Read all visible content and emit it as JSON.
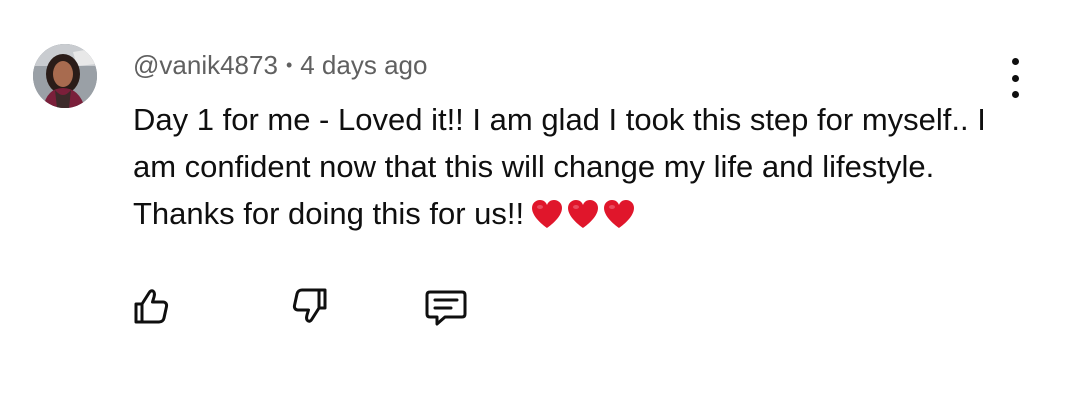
{
  "comment": {
    "author": "@vanik4873",
    "separator": "•",
    "timestamp": "4 days ago",
    "text": "Day 1 for me - Loved it!! I am glad I took this step for myself.. I am confident now that this will change my life and lifestyle. Thanks for doing this for us!!",
    "emoji": "red-heart x3",
    "heart_color": "#e0162b"
  },
  "actions": {
    "like_icon": "thumbs-up-icon",
    "dislike_icon": "thumbs-down-icon",
    "reply_icon": "comment-reply-icon",
    "more_icon": "more-vertical-icon"
  }
}
